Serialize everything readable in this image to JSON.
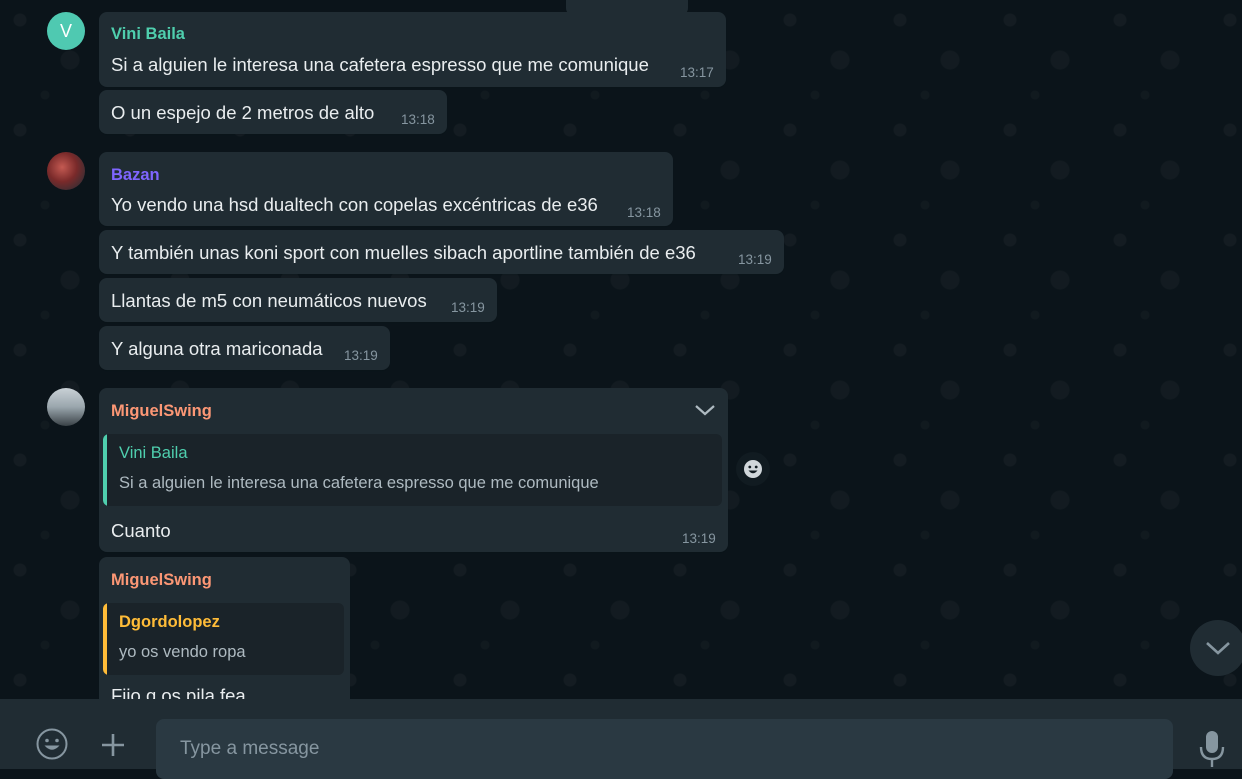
{
  "chat": {
    "messages": [
      {
        "sender": "Vini Baila",
        "avatar_letter": "V",
        "text": "Si a alguien le interesa una cafetera espresso que me comunique",
        "time": "13:17"
      },
      {
        "text": "O un espejo de 2 metros de alto",
        "time": "13:18"
      },
      {
        "sender": "Bazan",
        "text": "Yo vendo una hsd dualtech con copelas excéntricas de e36",
        "time": "13:18"
      },
      {
        "text": "Y también unas koni sport con muelles sibach aportline también de e36",
        "time": "13:19"
      },
      {
        "text": "Llantas de m5 con neumáticos nuevos",
        "time": "13:19"
      },
      {
        "text": "Y alguna otra mariconada",
        "time": "13:19"
      },
      {
        "sender": "MiguelSwing",
        "quoted": {
          "sender": "Vini Baila",
          "text": "Si a alguien le interesa una cafetera espresso que me comunique"
        },
        "text": "Cuanto",
        "time": "13:19"
      },
      {
        "sender": "MiguelSwing",
        "quoted": {
          "sender": "Dgordolopez",
          "text": "yo os vendo ropa"
        },
        "text": "Fijo q os pila fea"
      }
    ]
  },
  "composer": {
    "placeholder": "Type a message"
  },
  "colors": {
    "vini": "#53bdeb",
    "vini_name": "#4fcfae",
    "bazan": "#7f66ff",
    "miguel": "#fc9775",
    "dgordo": "#ffbc38",
    "bubble": "#202c33",
    "background": "#0b141a"
  },
  "icons": [
    "emoji-icon",
    "plus-icon",
    "mic-icon",
    "chevron-down-icon",
    "scroll-down-icon",
    "reaction-emoji-icon"
  ]
}
